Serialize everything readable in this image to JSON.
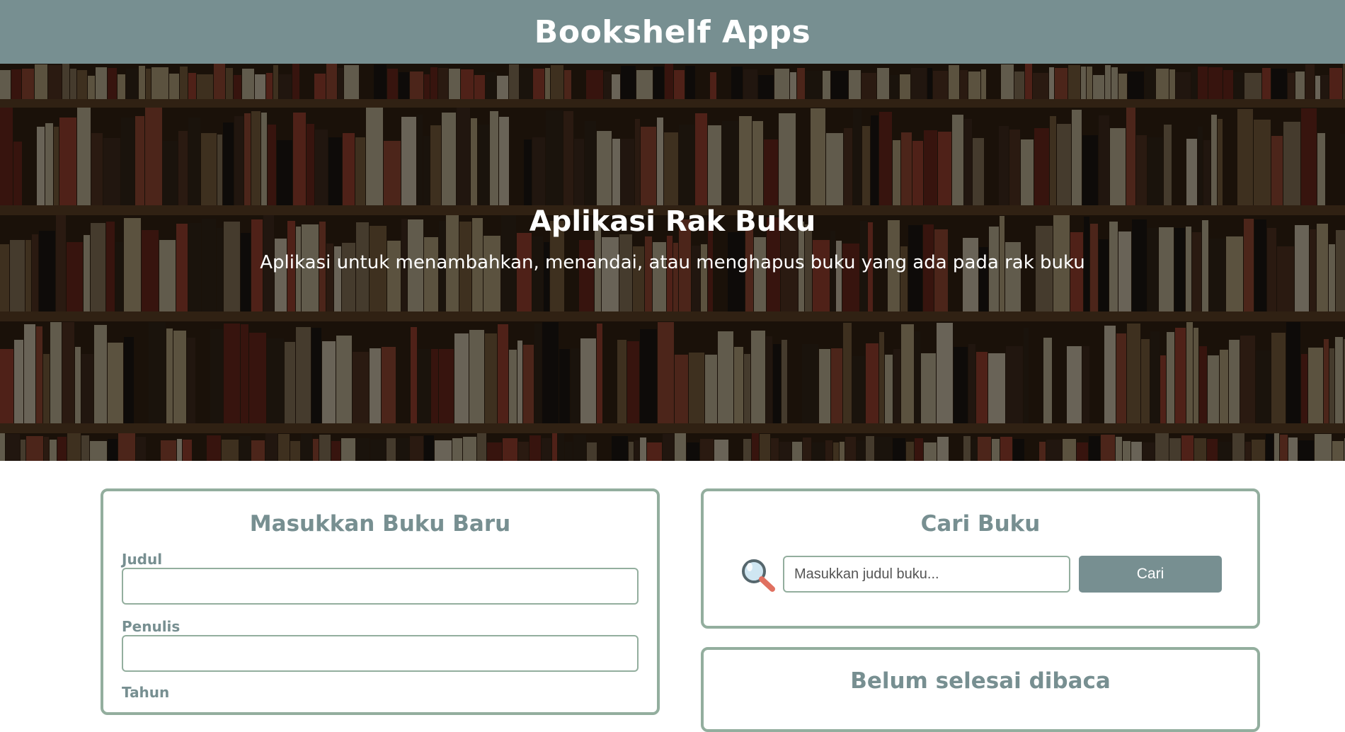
{
  "header": {
    "title": "Bookshelf Apps"
  },
  "hero": {
    "title": "Aplikasi Rak Buku",
    "subtitle": "Aplikasi untuk menambahkan, menandai, atau menghapus buku yang ada pada rak buku"
  },
  "add_book": {
    "title": "Masukkan Buku Baru",
    "fields": [
      {
        "label": "Judul",
        "value": ""
      },
      {
        "label": "Penulis",
        "value": ""
      },
      {
        "label": "Tahun",
        "value": ""
      }
    ]
  },
  "search": {
    "title": "Cari Buku",
    "placeholder": "Masukkan judul buku...",
    "button_label": "Cari",
    "icon": "magnifier-icon"
  },
  "unread_shelf": {
    "title": "Belum selesai dibaca"
  },
  "colors": {
    "header_bg": "#778f91",
    "card_border": "#93ae9e",
    "accent_text": "#778f91"
  }
}
